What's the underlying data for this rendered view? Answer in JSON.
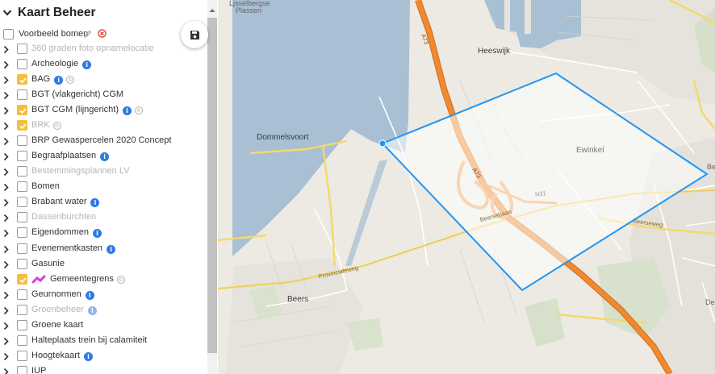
{
  "panel": {
    "title": "Kaart Beheer",
    "example_layer": "Voorbeeld bomen",
    "layers": [
      {
        "label": "360 graden foto opnamelocatie",
        "checked": false,
        "disabled": true,
        "info": false,
        "copyright": false,
        "swatch": false
      },
      {
        "label": "Archeologie",
        "checked": false,
        "disabled": false,
        "info": true,
        "copyright": false,
        "swatch": false
      },
      {
        "label": "BAG",
        "checked": true,
        "disabled": false,
        "info": true,
        "copyright": true,
        "swatch": false
      },
      {
        "label": "BGT (vlakgericht) CGM",
        "checked": false,
        "disabled": false,
        "info": false,
        "copyright": false,
        "swatch": false
      },
      {
        "label": "BGT CGM (lijngericht)",
        "checked": true,
        "disabled": false,
        "info": true,
        "copyright": true,
        "swatch": false
      },
      {
        "label": "BRK",
        "checked": true,
        "disabled": true,
        "info": false,
        "copyright": true,
        "swatch": false
      },
      {
        "label": "BRP Gewaspercelen 2020 Concept",
        "checked": false,
        "disabled": false,
        "info": false,
        "copyright": false,
        "swatch": false
      },
      {
        "label": "Begraafplaatsen",
        "checked": false,
        "disabled": false,
        "info": true,
        "copyright": false,
        "swatch": false
      },
      {
        "label": "Bestemmingsplannen LV",
        "checked": false,
        "disabled": true,
        "info": false,
        "copyright": false,
        "swatch": false
      },
      {
        "label": "Bomen",
        "checked": false,
        "disabled": false,
        "info": false,
        "copyright": false,
        "swatch": false
      },
      {
        "label": "Brabant water",
        "checked": false,
        "disabled": false,
        "info": true,
        "copyright": false,
        "swatch": false
      },
      {
        "label": "Dassenburchten",
        "checked": false,
        "disabled": true,
        "info": false,
        "copyright": false,
        "swatch": false
      },
      {
        "label": "Eigendommen",
        "checked": false,
        "disabled": false,
        "info": true,
        "copyright": false,
        "swatch": false
      },
      {
        "label": "Evenementkasten",
        "checked": false,
        "disabled": false,
        "info": true,
        "copyright": false,
        "swatch": false
      },
      {
        "label": "Gasunie",
        "checked": false,
        "disabled": false,
        "info": false,
        "copyright": false,
        "swatch": false
      },
      {
        "label": "Gemeentegrens",
        "checked": true,
        "disabled": false,
        "info": false,
        "copyright": true,
        "swatch": true
      },
      {
        "label": "Geurnormen",
        "checked": false,
        "disabled": false,
        "info": true,
        "copyright": false,
        "swatch": false
      },
      {
        "label": "Groenbeheer",
        "checked": false,
        "disabled": true,
        "info": true,
        "copyright": false,
        "swatch": false
      },
      {
        "label": "Groene kaart",
        "checked": false,
        "disabled": false,
        "info": false,
        "copyright": false,
        "swatch": false
      },
      {
        "label": "Halteplaats trein bij calamiteit",
        "checked": false,
        "disabled": false,
        "info": false,
        "copyright": false,
        "swatch": false
      },
      {
        "label": "Hoogtekaart",
        "checked": false,
        "disabled": false,
        "info": true,
        "copyright": false,
        "swatch": false
      },
      {
        "label": "IUP",
        "checked": false,
        "disabled": false,
        "info": false,
        "copyright": false,
        "swatch": false
      }
    ]
  },
  "icons": {
    "collapse": "chevron-down-icon",
    "save": "floppy-disk-icon",
    "edit": "pencil-icon",
    "remove": "circle-x-icon",
    "expand": "chevron-right-icon",
    "info": "info-icon",
    "copyright": "copyright-icon"
  },
  "colors": {
    "checked": "#f5be3d",
    "info": "#2f7ae5",
    "polygon": "#2196f3",
    "highway": "#ef8a2e",
    "water": "#a9bfd4",
    "swatch": "#d63fd1"
  },
  "map": {
    "places": {
      "heeswijk": "Heeswijk",
      "dommelsvoort": "Dommelsvoort",
      "ewinkel": "Ewinkel",
      "beers": "Beers",
      "top_label_1": "Ljsselbergse",
      "top_label_2": "Plassen",
      "edge_be": "Be",
      "edge_de": "De"
    },
    "roads": {
      "a73_north": "A73",
      "a73_south": "A73",
      "provincialeweg": "Provincialeweg",
      "beerseb": "Beersebaan",
      "beerseweg": "Beerseweg",
      "n_label": "N31"
    }
  }
}
